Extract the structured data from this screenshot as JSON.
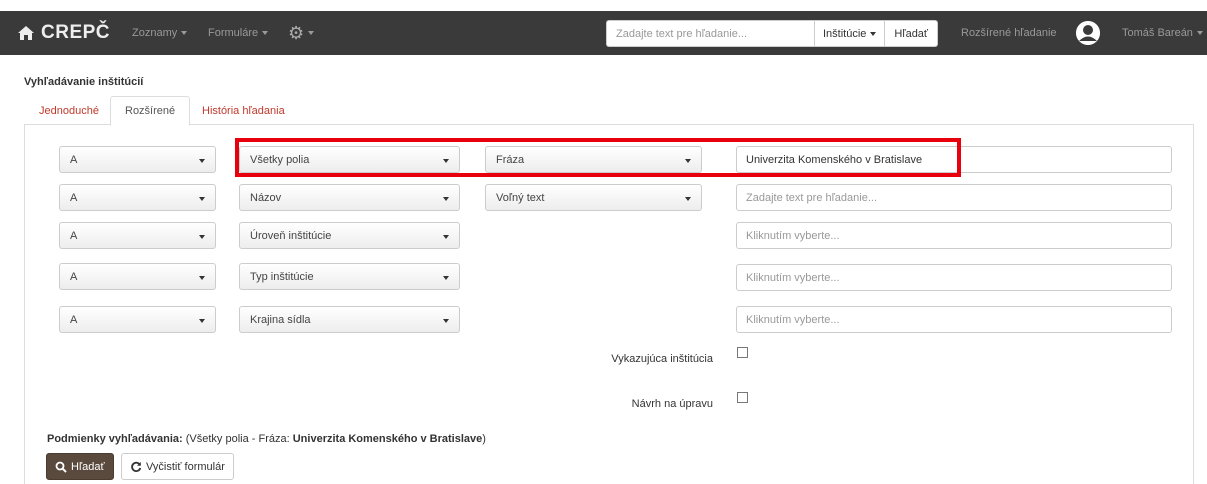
{
  "navbar": {
    "brand": "CREPČ",
    "menu_lists": "Zoznamy",
    "menu_forms": "Formuláre",
    "search_placeholder": "Zadajte text pre hľadanie...",
    "search_scope": "Inštitúcie",
    "search_button": "Hľadať",
    "advanced_search": "Rozšírené hľadanie",
    "user_name": "Tomáš Bareán"
  },
  "page": {
    "title": "Vyhľadávanie inštitúcií",
    "tabs": [
      {
        "label": "Jednoduché"
      },
      {
        "label": "Rozšírené"
      },
      {
        "label": "História hľadania"
      }
    ]
  },
  "criteria": [
    {
      "operator": "A",
      "field": "Všetky polia",
      "mode": "Fráza",
      "value": "Univerzita Komenského v Bratislave",
      "placeholder": ""
    },
    {
      "operator": "A",
      "field": "Názov",
      "mode": "Voľný text",
      "value": "",
      "placeholder": "Zadajte text pre hľadanie..."
    },
    {
      "operator": "A",
      "field": "Úroveň inštitúcie",
      "value": "",
      "placeholder": "Kliknutím vyberte..."
    },
    {
      "operator": "A",
      "field": "Typ inštitúcie",
      "value": "",
      "placeholder": "Kliknutím vyberte..."
    },
    {
      "operator": "A",
      "field": "Krajina sídla",
      "value": "",
      "placeholder": "Kliknutím vyberte..."
    }
  ],
  "checkboxes": {
    "reporting_label": "Vykazujúca inštitúcia",
    "reporting_checked": false,
    "proposal_label": "Návrh na úpravu",
    "proposal_checked": false
  },
  "conditions": {
    "label": "Podmienky vyhľadávania:",
    "prefix": "(Všetky polia - Fráza: ",
    "value": "Univerzita Komenského v Bratislave",
    "suffix": ")"
  },
  "actions": {
    "search": "Hľadať",
    "clear": "Vyčistiť formulár"
  },
  "colors": {
    "navbar_bg": "#3a3a3a",
    "tab_link": "#c0392b",
    "search_button_bg": "#5a4a3d",
    "highlight": "#e8000c"
  }
}
